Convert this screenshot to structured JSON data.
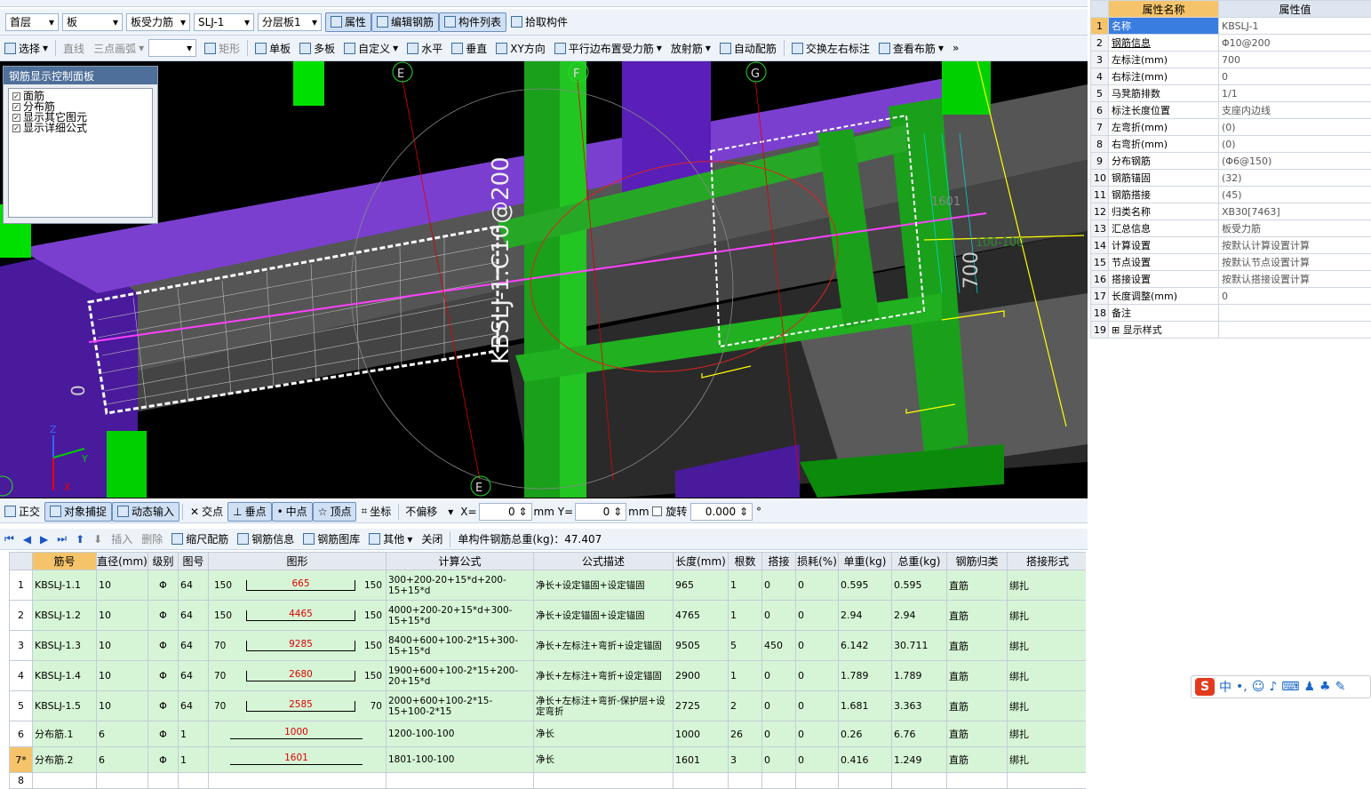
{
  "toolbar1": {
    "floor": "首层",
    "type": "板",
    "subtype": "板受力筋",
    "component": "SLJ-1",
    "layer": "分层板1",
    "props_btn": "属性",
    "edit_btn": "编辑钢筋",
    "list_btn": "构件列表",
    "pick_btn": "拾取构件"
  },
  "toolbar2": {
    "select": "选择",
    "line": "直线",
    "arc": "三点画弧",
    "rect": "矩形",
    "single": "单板",
    "multi": "多板",
    "custom": "自定义",
    "horizontal": "水平",
    "vertical": "垂直",
    "xy": "XY方向",
    "parallel": "平行边布置受力筋",
    "radial": "放射筋",
    "auto": "自动配筋",
    "swap": "交换左右标注",
    "view": "查看布筋"
  },
  "panel": {
    "title": "钢筋显示控制面板",
    "items": [
      "面筋",
      "分布筋",
      "显示其它图元",
      "显示详细公式"
    ]
  },
  "viewport": {
    "axes": [
      "E",
      "F",
      "G",
      "E"
    ],
    "label_main": "KBSLJ-1:C10@200",
    "label_700": "700",
    "label_1601": "1601",
    "label_100": "100-100",
    "label_0": "0"
  },
  "snapbar": {
    "ortho": "正交",
    "snap": "对象捕捉",
    "dyn": "动态输入",
    "intersect": "交点",
    "perp": "垂点",
    "mid": "中点",
    "vertex": "顶点",
    "coord": "坐标",
    "offset": "不偏移",
    "x_label": "X=",
    "x_val": "0",
    "mm1": "mm",
    "y_label": "Y=",
    "y_val": "0",
    "mm2": "mm",
    "rotate": "旋转",
    "rot_val": "0.000"
  },
  "gridbar": {
    "insert": "插入",
    "delete": "删除",
    "scale": "缩尺配筋",
    "rebar_info": "钢筋信息",
    "rebar_lib": "钢筋图库",
    "other": "其他",
    "close": "关闭",
    "total": "单构件钢筋总重(kg)：47.407"
  },
  "grid": {
    "headers": [
      "筋号",
      "直径(mm)",
      "级别",
      "图号",
      "图形",
      "计算公式",
      "公式描述",
      "长度(mm)",
      "根数",
      "搭接",
      "损耗(%)",
      "单重(kg)",
      "总重(kg)",
      "钢筋归类",
      "搭接形式"
    ],
    "rows": [
      {
        "n": "1",
        "name": "KBSLJ-1.1",
        "d": "10",
        "lv": "Φ",
        "fig": "64",
        "sl": "150",
        "sm": "665",
        "sr": "150",
        "f": "300+200-20+15*d+200-15+15*d",
        "desc": "净长+设定锚固+设定锚固",
        "len": "965",
        "cnt": "1",
        "lap": "0",
        "loss": "0",
        "uw": "0.595",
        "tw": "0.595",
        "cls": "直筋",
        "lt": "绑扎"
      },
      {
        "n": "2",
        "name": "KBSLJ-1.2",
        "d": "10",
        "lv": "Φ",
        "fig": "64",
        "sl": "150",
        "sm": "4465",
        "sr": "150",
        "f": "4000+200-20+15*d+300-15+15*d",
        "desc": "净长+设定锚固+设定锚固",
        "len": "4765",
        "cnt": "1",
        "lap": "0",
        "loss": "0",
        "uw": "2.94",
        "tw": "2.94",
        "cls": "直筋",
        "lt": "绑扎"
      },
      {
        "n": "3",
        "name": "KBSLJ-1.3",
        "d": "10",
        "lv": "Φ",
        "fig": "64",
        "sl": "70",
        "sm": "9285",
        "sr": "150",
        "f": "8400+600+100-2*15+300-15+15*d",
        "desc": "净长+左标注+弯折+设定锚固",
        "len": "9505",
        "cnt": "5",
        "lap": "450",
        "loss": "0",
        "uw": "6.142",
        "tw": "30.711",
        "cls": "直筋",
        "lt": "绑扎"
      },
      {
        "n": "4",
        "name": "KBSLJ-1.4",
        "d": "10",
        "lv": "Φ",
        "fig": "64",
        "sl": "70",
        "sm": "2680",
        "sr": "150",
        "f": "1900+600+100-2*15+200-20+15*d",
        "desc": "净长+左标注+弯折+设定锚固",
        "len": "2900",
        "cnt": "1",
        "lap": "0",
        "loss": "0",
        "uw": "1.789",
        "tw": "1.789",
        "cls": "直筋",
        "lt": "绑扎"
      },
      {
        "n": "5",
        "name": "KBSLJ-1.5",
        "d": "10",
        "lv": "Φ",
        "fig": "64",
        "sl": "70",
        "sm": "2585",
        "sr": "70",
        "f": "2000+600+100-2*15-15+100-2*15",
        "desc": "净长+左标注+弯折-保护层+设定弯折",
        "len": "2725",
        "cnt": "2",
        "lap": "0",
        "loss": "0",
        "uw": "1.681",
        "tw": "3.363",
        "cls": "直筋",
        "lt": "绑扎"
      },
      {
        "n": "6",
        "name": "分布筋.1",
        "d": "6",
        "lv": "Φ",
        "fig": "1",
        "sl": "",
        "sm": "1000",
        "sr": "",
        "f": "1200-100-100",
        "desc": "净长",
        "len": "1000",
        "cnt": "26",
        "lap": "0",
        "loss": "0",
        "uw": "0.26",
        "tw": "6.76",
        "cls": "直筋",
        "lt": "绑扎"
      },
      {
        "n": "7*",
        "name": "分布筋.2",
        "d": "6",
        "lv": "Φ",
        "fig": "1",
        "sl": "",
        "sm": "1601",
        "sr": "",
        "f": "1801-100-100",
        "desc": "净长",
        "len": "1601",
        "cnt": "3",
        "lap": "0",
        "loss": "0",
        "uw": "0.416",
        "tw": "1.249",
        "cls": "直筋",
        "lt": "绑扎"
      }
    ],
    "empty_row": "8"
  },
  "props": {
    "h_name": "属性名称",
    "h_val": "属性值",
    "rows": [
      [
        "1",
        "名称",
        "KBSLJ-1"
      ],
      [
        "2",
        "钢筋信息",
        "Φ10@200"
      ],
      [
        "3",
        "左标注(mm)",
        "700"
      ],
      [
        "4",
        "右标注(mm)",
        "0"
      ],
      [
        "5",
        "马凳筋排数",
        "1/1"
      ],
      [
        "6",
        "标注长度位置",
        "支座内边线"
      ],
      [
        "7",
        "左弯折(mm)",
        "(0)"
      ],
      [
        "8",
        "右弯折(mm)",
        "(0)"
      ],
      [
        "9",
        "分布钢筋",
        "(Φ6@150)"
      ],
      [
        "10",
        "钢筋锚固",
        "(32)"
      ],
      [
        "11",
        "钢筋搭接",
        "(45)"
      ],
      [
        "12",
        "归类名称",
        "XB30[7463]"
      ],
      [
        "13",
        "汇总信息",
        "板受力筋"
      ],
      [
        "14",
        "计算设置",
        "按默认计算设置计算"
      ],
      [
        "15",
        "节点设置",
        "按默认节点设置计算"
      ],
      [
        "16",
        "搭接设置",
        "按默认搭接设置计算"
      ],
      [
        "17",
        "长度调整(mm)",
        "0"
      ],
      [
        "18",
        "备注",
        ""
      ],
      [
        "19",
        "显示样式",
        ""
      ]
    ]
  },
  "ime": {
    "logo": "S",
    "lang": "中"
  }
}
